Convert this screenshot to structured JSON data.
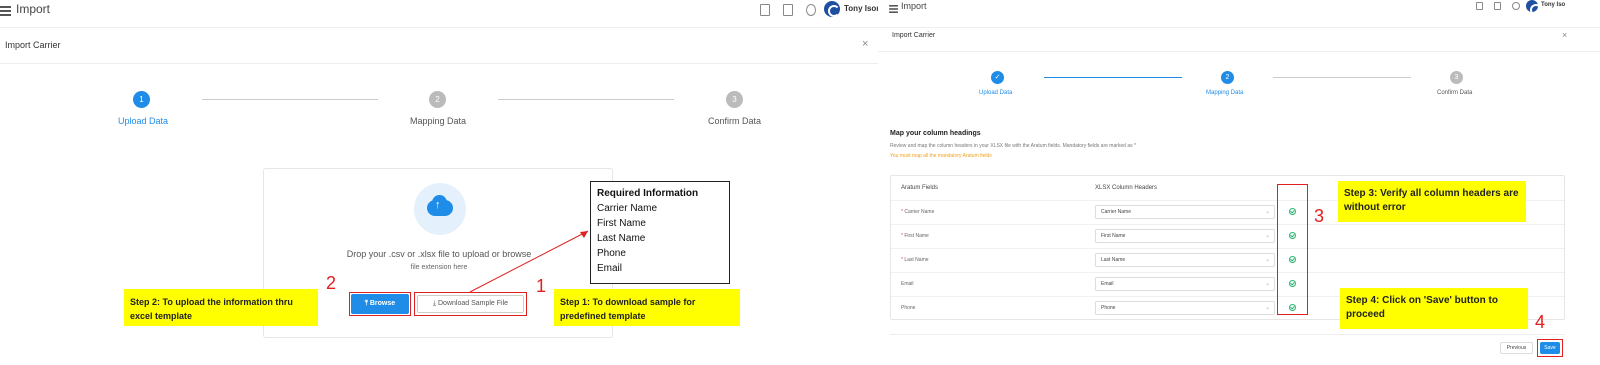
{
  "left": {
    "app_title": "Import",
    "user_name": "Tony Isor",
    "dialog_title": "Import Carrier",
    "close_glyph": "×",
    "steps": [
      {
        "num": "1",
        "label": "Upload Data",
        "state": "active"
      },
      {
        "num": "2",
        "label": "Mapping Data",
        "state": "pending"
      },
      {
        "num": "3",
        "label": "Confirm Data",
        "state": "pending"
      }
    ],
    "drop_text": "Drop your .csv or .xlsx file to upload or browse",
    "drop_sub": "file extension here",
    "browse_label": "⤒ Browse",
    "download_label": "⤓ Download Sample File",
    "required_info": {
      "heading": "Required Information",
      "items": [
        "Carrier Name",
        "First Name",
        "Last Name",
        "Phone",
        "Email"
      ]
    },
    "callouts": {
      "step1": "Step 1: To download sample for predefined template",
      "step2": "Step 2: To upload the information thru excel template"
    },
    "numbers": {
      "n1": "1",
      "n2": "2"
    }
  },
  "right": {
    "app_title": "Import",
    "user_name": "Tony Iso",
    "dialog_title": "Import Carrier",
    "close_glyph": "×",
    "steps": [
      {
        "num": "✓",
        "label": "Upload Data",
        "state": "done"
      },
      {
        "num": "2",
        "label": "Mapping Data",
        "state": "active"
      },
      {
        "num": "3",
        "label": "Confirm Data",
        "state": "pending"
      }
    ],
    "map_title": "Map your column headings",
    "map_desc": "Review and map the column headers in your XLSX file with the Aratum fields. Mandatory fields are marked as *",
    "map_warn": "You must map all the mandatory Aratum fields",
    "col_aratum": "Aratum Fields",
    "col_xlsx": "XLSX Column Headers",
    "rows": [
      {
        "field": "Carrier Name",
        "required": true,
        "value": "Carrier Name"
      },
      {
        "field": "First Name",
        "required": true,
        "value": "First Name"
      },
      {
        "field": "Last Name",
        "required": true,
        "value": "Last Name"
      },
      {
        "field": "Email",
        "required": false,
        "value": "Email"
      },
      {
        "field": "Phone",
        "required": false,
        "value": "Phone"
      }
    ],
    "previous_label": "Previous",
    "save_label": "Save",
    "callouts": {
      "step3": "Step 3: Verify all column headers are without error",
      "step4": "Step 4: Click on 'Save' button to proceed"
    },
    "numbers": {
      "n3": "3",
      "n4": "4"
    }
  },
  "colors": {
    "primary": "#1f8de8",
    "callout": "#ffff00",
    "annotation_red": "#e02020",
    "success": "#2bb673"
  }
}
